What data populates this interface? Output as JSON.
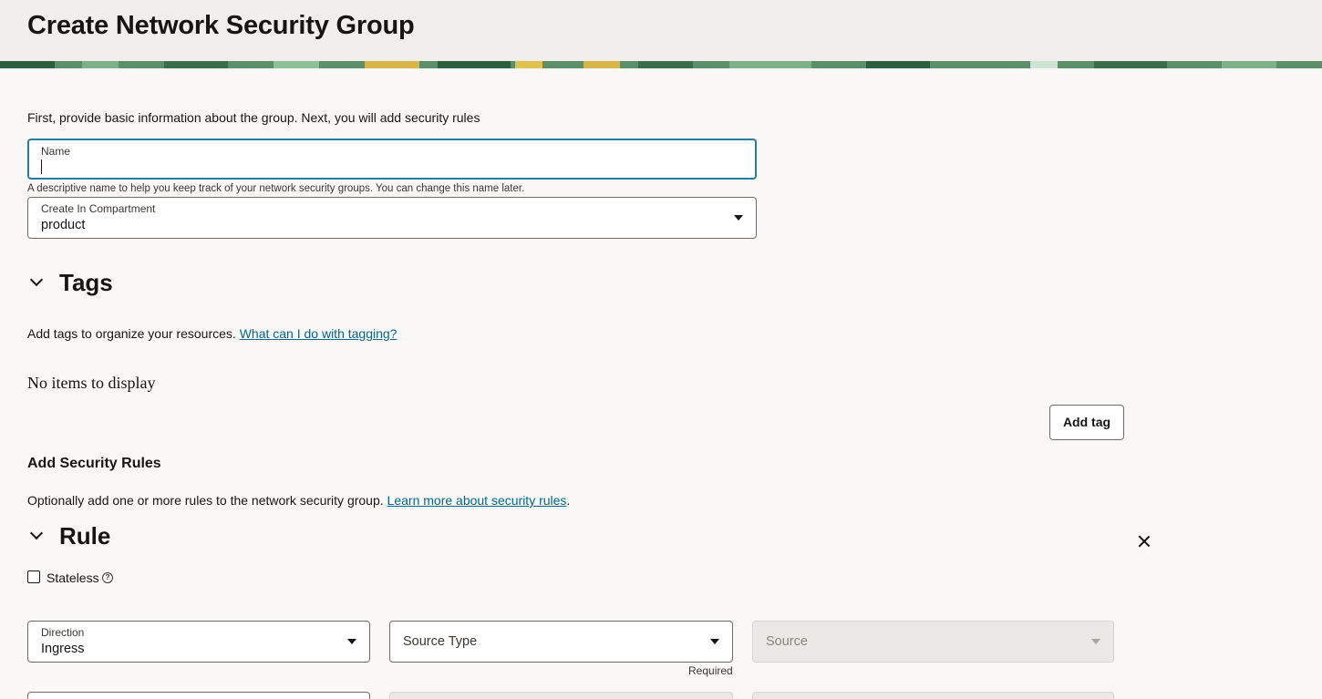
{
  "header": {
    "title": "Create Network Security Group"
  },
  "form": {
    "intro": "First, provide basic information about the group. Next, you will add security rules",
    "name_field": {
      "label": "Name",
      "value": ""
    },
    "name_hint": "A descriptive name to help you keep track of your network security groups. You can change this name later.",
    "compartment_field": {
      "label": "Create In Compartment",
      "value": "product"
    }
  },
  "tags": {
    "heading": "Tags",
    "description": "Add tags to organize your resources.",
    "link": "What can I do with tagging?",
    "empty": "No items to display",
    "add_button": "Add tag"
  },
  "security_rules": {
    "heading": "Add Security Rules",
    "description": "Optionally add one or more rules to the network security group.",
    "link": "Learn more about security rules",
    "link_suffix": "."
  },
  "rule": {
    "heading": "Rule",
    "stateless_label": "Stateless",
    "help_glyph": "?",
    "direction": {
      "label": "Direction",
      "value": "Ingress"
    },
    "source_type": {
      "placeholder": "Source Type",
      "required_text": "Required"
    },
    "source": {
      "placeholder": "Source"
    }
  },
  "colors": {
    "accent": "#227e9e",
    "link": "#00688c",
    "banner": "#5a8f69"
  },
  "icons": [
    "chevron-down-icon",
    "caret-down-icon",
    "close-icon",
    "help-icon"
  ]
}
